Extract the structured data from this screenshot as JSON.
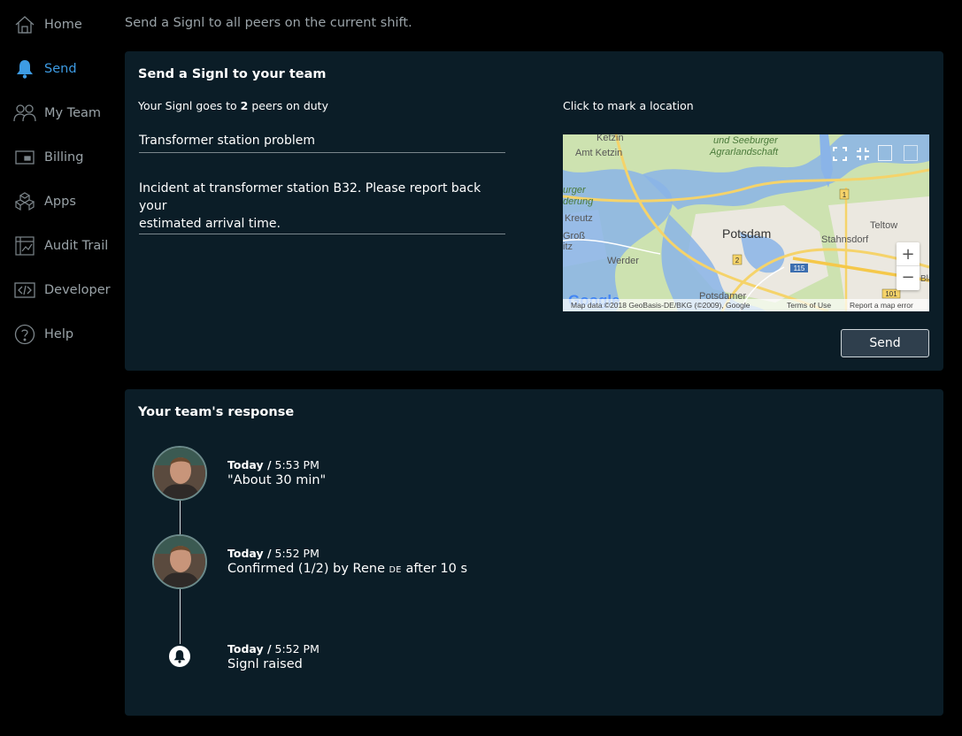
{
  "sidebar": {
    "items": [
      {
        "label": "Home",
        "icon": "home-icon",
        "active": false
      },
      {
        "label": "Send",
        "icon": "bell-icon",
        "active": true
      },
      {
        "label": "My Team",
        "icon": "team-icon",
        "active": false
      },
      {
        "label": "Billing",
        "icon": "billing-icon",
        "active": false
      },
      {
        "label": "Apps",
        "icon": "apps-icon",
        "active": false
      },
      {
        "label": "Audit Trail",
        "icon": "audit-trail-icon",
        "active": false
      },
      {
        "label": "Developer",
        "icon": "code-icon",
        "active": false
      },
      {
        "label": "Help",
        "icon": "help-icon",
        "active": false
      }
    ]
  },
  "page": {
    "subtitle": "Send a Signl to all peers on the current shift."
  },
  "send_card": {
    "title": "Send a Signl to your team",
    "peers_prefix": "Your Signl goes to ",
    "peers_count": "2",
    "peers_suffix": " peers on duty",
    "subject_value": "Transformer station problem",
    "message_line1": "Incident at transformer station B32. Please report back your",
    "message_line2": "estimated arrival time.",
    "map_hint": "Click to mark a location",
    "send_label": "Send"
  },
  "map": {
    "labels": {
      "ketzin": "Ketzin",
      "amt_ketzin": "Amt Ketzin",
      "seeburger_1": "und Seeburger",
      "seeburger_2": "Agrarlandschaft",
      "burger": "urger",
      "derung": "derung",
      "kreutz": "Kreutz",
      "gross": "Groß",
      "itz": "itz",
      "potsdam": "Potsdam",
      "stahnsdorf": "Stahnsdorf",
      "teltow": "Teltow",
      "werder": "Werder",
      "potsdamer": "Potsdamer",
      "shield_1": "1",
      "shield_2": "2",
      "shield_115": "115",
      "shield_101": "101",
      "google": "Google",
      "blank_edge": "Bla"
    },
    "zoom_in": "+",
    "zoom_out": "−",
    "attribution": "Map data ©2018 GeoBasis-DE/BKG (©2009), Google",
    "terms": "Terms of Use",
    "report": "Report a map error",
    "colors": {
      "land": "#cfe3b4",
      "water": "#8ab4e8",
      "road": "#f5d36a",
      "urban": "#ebe8e0"
    }
  },
  "response_card": {
    "title": "Your team's response",
    "entries": [
      {
        "day": "Today /",
        "time": "5:53 PM",
        "text": "\"About 30 min\""
      },
      {
        "day": "Today /",
        "time": "5:52 PM",
        "text_prefix": "Confirmed (1/2) by Rene ",
        "text_tag": "DE",
        "text_suffix": " after 10 s"
      },
      {
        "day": "Today /",
        "time": "5:52 PM",
        "text": "Signl raised"
      }
    ]
  },
  "colors": {
    "background": "#000000",
    "card": "#0b1d27",
    "accent": "#3d9be3",
    "muted": "#9aa3a8"
  }
}
